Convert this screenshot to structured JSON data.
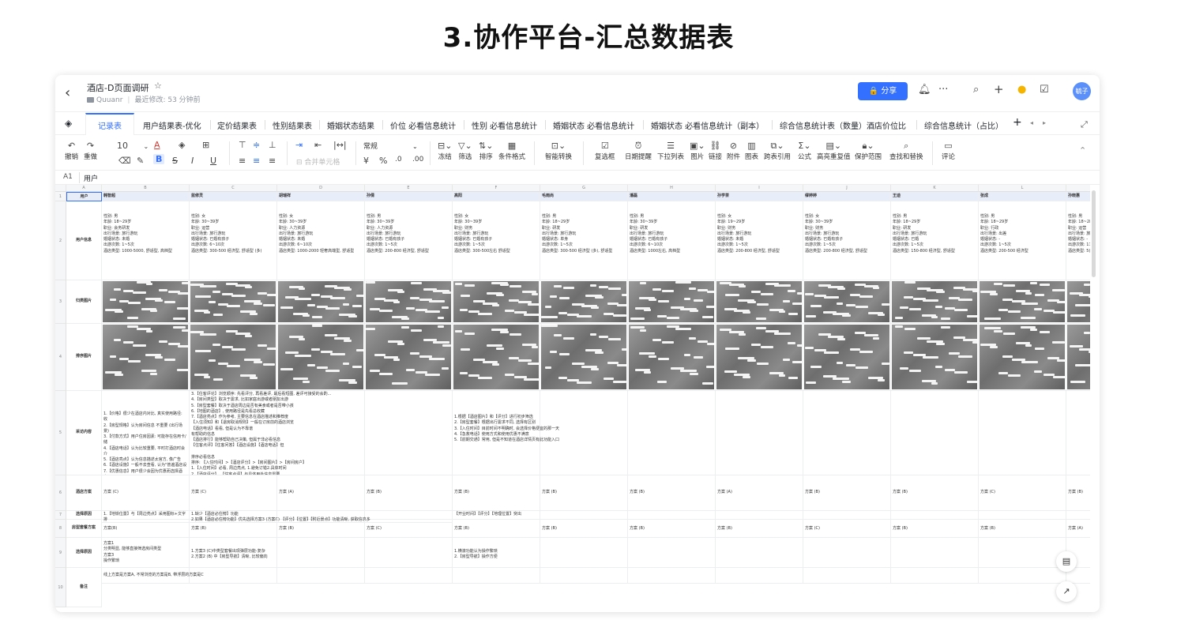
{
  "slide_title": "3.协作平台-汇总数据表",
  "header": {
    "doc_title": "酒店-D页面调研",
    "owner": "Quuanr",
    "modified": "最近修改: 53 分钟前",
    "share": "分享",
    "avatar": "毓子"
  },
  "tabs": [
    "记录表",
    "用户结果表-优化",
    "定价结果表",
    "性别结果表",
    "婚姻状态结果",
    "价位 必看信息统计",
    "性别 必看信息统计",
    "婚姻状态 必看信息统计",
    "婚姻状态 必看信息统计（副本）",
    "综合信息统计表（数量）酒店价位比",
    "综合信息统计（占比）"
  ],
  "toolbar": {
    "undo": "撤销",
    "redo": "重做",
    "font_size": "10",
    "number_format": "常规",
    "merge": "合并单元格",
    "freeze": "冻结",
    "filter": "筛选",
    "sort": "排序",
    "cond_format": "条件格式",
    "smart_convert": "智能转换",
    "checkbox": "复选框",
    "date_reminder": "日期提醒",
    "dropdown": "下拉列表",
    "image": "图片",
    "link": "链接",
    "attachment": "附件",
    "chart": "图表",
    "cross_ref": "跨表引用",
    "formula": "公式",
    "highlight_dup": "高亮重复值",
    "protect": "保护范围",
    "find_replace": "查找和替换",
    "comment": "评论"
  },
  "formula_bar": {
    "ref": "A1",
    "value": "用户"
  },
  "sheet": {
    "col_letters": [
      "A",
      "B",
      "C",
      "D",
      "E",
      "F",
      "G",
      "H",
      "I",
      "J",
      "K",
      "L",
      "M"
    ],
    "header_row": [
      "用户",
      "韩智超",
      "蓝修灵",
      "胡瑞祥",
      "孙倩",
      "高阳",
      "毛雨尚",
      "潘磊",
      "孙学茶",
      "缪婷婷",
      "王迪",
      "张成",
      "孙晓惠"
    ],
    "row_labels": [
      "用户信息",
      "归类图片",
      "排序图片",
      "采访内容",
      "酒店方案",
      "选择原因",
      "房型套餐方案",
      "选择原因",
      "备注"
    ],
    "user_info": [
      "性别: 男\n年龄: 18~29岁\n职业: 会务研发\n出行场景: 旅行游玩\n婚姻状态: 未婚\n出游次数: 1~5次\n酒店类型: 1000-5000, 舒适型, 高档型",
      "性别: 女\n年龄: 30~39岁\n职业: 运营\n出行场景: 旅行游玩\n婚姻状态: 已婚有孩子\n出游次数: 6~10次\n酒店类型: 300-500 经济型, 舒适型 (多)",
      "性别: 女\n年龄: 30~39岁\n职业: 人力资源\n出行场景: 旅行游玩\n婚姻状态: 未婚\n出游次数: 6~10次\n酒店类型: 1000-2000 轻奢高端型, 舒适型",
      "性别: 男\n年龄: 30~39岁\n职业: 人力资源\n出行场景: 旅行游玩\n婚姻状态: 已婚有孩子\n出游次数: 1~5次\n酒店类型: 200-800 经济型, 舒适型",
      "性别: 女\n年龄: 30~39岁\n职业: 财务\n出行场景: 旅行游玩\n婚姻状态: 已婚有孩子\n出游次数: 1~5次\n酒店类型: 300-500左右 舒适型",
      "性别: 男\n年龄: 18~29岁\n职业: 研发\n出行场景: 旅行游玩\n婚姻状态: 单身\n出游次数: 1~5次\n酒店类型: 300-500 经济型 (多), 舒适型",
      "性别: 男\n年龄: 30~39岁\n职业: 研发\n出行场景: 旅行游玩\n婚姻状态: 已婚有孩子\n出游次数: 6~10次\n酒店类型: 1000左右, 高档型",
      "性别: 女\n年龄: 19~29岁\n职业: 财务\n出行场景: 旅行游玩\n婚姻状态: 未婚\n出游次数: 1~5次\n酒店类型: 200-800 经济型, 舒适型",
      "性别: 女\n年龄: 30~39岁\n职业: 财务\n出行场景: 旅行游玩\n婚姻状态: 已婚有孩子\n出游次数: 1~5次\n酒店类型: 200-800 经济型, 舒适型",
      "性别: 男\n年龄: 18~29岁\n职业: 研发\n出行场景: 旅行游玩\n婚姻状态: 已婚\n出游次数: 1~5次\n酒店类型: 150-800 经济型, 舒适型",
      "性别: 男\n年龄: 18~29岁\n职业: 行政\n出行场景: 出差\n婚姻状态: -\n出游次数: 1~5次\n酒店类型: 200-500 经济型",
      "性别: 男\n年龄: 18~28\n职业: 运营\n出行场景: 旅\n婚姻状态: -\n出游次数: 11\n酒店类型: 5("
    ],
    "interview_b": "1.【价格】很少在酒店内对比, 真实使用路径: 收\n2.【房型规格】认为房间信息 不重要 (出行场景)\n3.【付款方式】用户住房因素: 可能存在信用卡/储\n4.【酒店电话】认为比较重要, 平时打酒店时会介\n5.【酒店亮点】认为信息描述太官方, 像广告\n6.【酒店设施】一般不去查看, 认为\"普遍酒店设\n7.【优惠信息】用户很少会因为优惠而选择酒店,",
    "interview_c": "3.【住客评论】浏览顺序: 先看评分, 再看差评, 最后看短图, 差评可接受的会酌...\n4.【房间类型】取决于需求, 比如家庭出游或者朋友出游\n5.【房型套餐】取决于酒店周边是否有美食或者是否带小孩\n6.【地图的酒店】, 使用路径是先看总收藏\n7.【酒店亮点】作为参考, 主要信息在酒店描述和推荐度\n【入住须知】和【退房取消规则】一般在订房前的酒店浏览\n【酒店电话】看看, 但是认为不靠谱\n有帮助的信息\n【酒店排行】能够帮助自己决策, 但属于非必看信息\n【住客点评】【住客问答】【酒店设施】【酒店电话】但\n\n排序必看信息\n排序: 【入住时间】>【酒店评分】>【房间图片】>【房间房户】\n1.【入住时间】必看, 周边亮点, 1.避免订错2.具体时间\n2.【酒店评分】、、【住客点评】与具体用处信息需要",
    "interview_g": "1.根据【酒店图片】和【评分】进行初步筛选\n2.【房型套餐】根据出行需求不同, 选择有区别\n3.【入住时间】目前时间不明确时, 会选择价格便宜的那一天\n4.【急救电话】使用方式和使用优惠不满意\n5.【前期交通】常用, 但是不知道在酒店详情页有此功能入口",
    "hotel_plan": [
      "方案 (C)",
      "方案 (C)",
      "方案 (A)",
      "方案 (B)",
      "方案 (B)",
      "方案 (B)",
      "方案 (B)",
      "方案 (A)",
      "方案 (B)",
      "方案 (B)",
      "方案 (C)",
      "方案 (B)"
    ],
    "hotel_reason_b": "1.【地铁位置】与【周边亮点】采用图标+文字排\n方案1 (默认) 问题:",
    "hotel_reason_c": "1.缺少【酒店必住榜】功能\n2.如果【酒店必住榜功能】优先选择方案3 (方案C)  【评分】【位置】【附近景点】功能清晰, 获取信息多",
    "hotel_reason_g": "【开业时间】【评分】【地理位置】突出",
    "room_plan": [
      "方案(B)",
      "方案 (B)",
      "方案 (B)",
      "方案 (C)",
      "方案 (B)",
      "方案 (B)",
      "方案 (B)",
      "方案 (B)",
      "方案 (C)",
      "方案 (B)",
      "方案 (B)",
      "方案 (A)"
    ],
    "room_reason_b": "方案1\n分类明显, 能够直接筛选房间类型\n方案3\n操作繁琐",
    "room_reason_c": "1.方案3 (C)中类型套餐出现弹层功能-复杂\n2.方案2 (B) 中【房型导航】清晰, 比较偏向",
    "room_reason_g": "1.横滚功能认为操作繁琐\n2.【房型导航】操作方便",
    "notes_b": "线上方案是方案A, 不常浏览的方案是B, 带浮层的方案是C"
  }
}
